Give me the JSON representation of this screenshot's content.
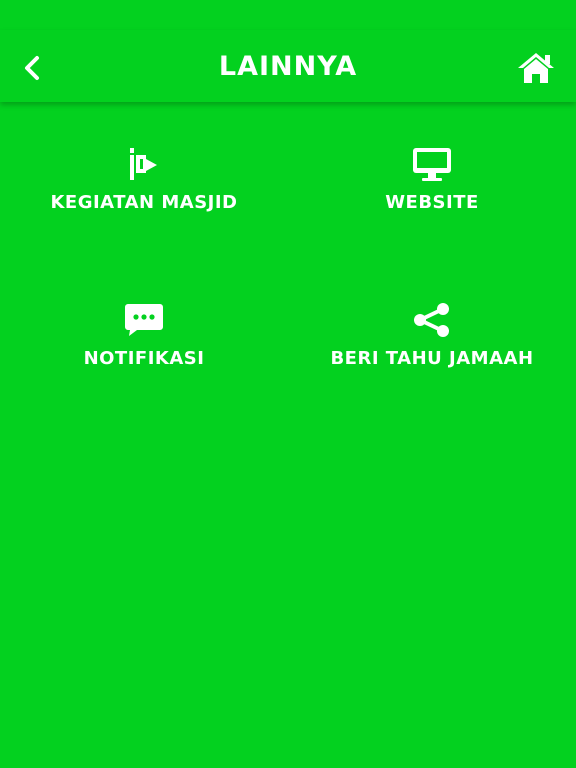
{
  "header": {
    "title": "LAINNYA",
    "back_icon": "chevron-left-icon",
    "home_icon": "home-icon"
  },
  "menu": [
    {
      "label": "KEGIATAN MASJID",
      "icon": "flag-icon"
    },
    {
      "label": "WEBSITE",
      "icon": "monitor-icon"
    },
    {
      "label": "NOTIFIKASI",
      "icon": "chat-bubble-icon"
    },
    {
      "label": "BERI TAHU JAMAAH",
      "icon": "share-icon"
    }
  ],
  "colors": {
    "background": "#03d11f",
    "foreground": "#ffffff"
  }
}
